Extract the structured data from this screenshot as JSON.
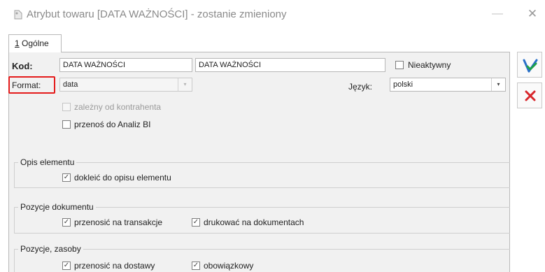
{
  "window": {
    "title": "Atrybut towaru [DATA WAŻNOŚCI] - zostanie zmieniony",
    "min_symbol": "—",
    "close_symbol": "✕"
  },
  "tabs": [
    {
      "accelerator": "1",
      "rest": " Ogólne"
    }
  ],
  "form": {
    "kod_label": "Kod:",
    "kod_value": "DATA WAŻNOŚCI",
    "kod_name_value": "DATA WAŻNOŚCI",
    "nieaktywny_label": "Nieaktywny",
    "format_label": "Format:",
    "format_value": "data",
    "jezyk_label": "Język:",
    "jezyk_value": "polski",
    "zalezny_label": "zależny od kontrahenta",
    "przenos_bi_label": "przenoś do Analiz BI"
  },
  "groups": {
    "opis": {
      "title": "Opis elementu",
      "dokleic_label": "dokleić do opisu elementu"
    },
    "pozycje_dokumentu": {
      "title": "Pozycje dokumentu",
      "transakcje_label": "przenosić na transakcje",
      "drukowac_label": "drukować na dokumentach"
    },
    "pozycje_zasoby": {
      "title": "Pozycje, zasoby",
      "dostawy_label": "przenosić na dostawy",
      "obowiazkowy_label": "obowiązkowy"
    }
  },
  "symbols": {
    "check": "✓",
    "dropdown": "▾"
  },
  "colors": {
    "highlight": "#e41b1b",
    "save_icon_blue": "#2a6fc9",
    "save_icon_green": "#1fa14a",
    "cancel_icon": "#d8262b"
  }
}
